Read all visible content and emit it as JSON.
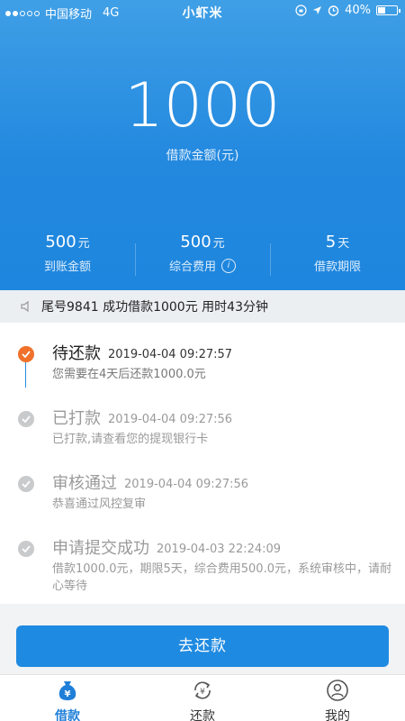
{
  "status_bar": {
    "carrier": "中国移动",
    "network": "4G",
    "center_text": "小虾米",
    "battery": "40%",
    "battery_level": 0.4
  },
  "loan": {
    "amount": "1000",
    "amount_label": "借款金额(元)",
    "stats": [
      {
        "value": "500",
        "unit": "元",
        "label": "到账金额"
      },
      {
        "value": "500",
        "unit": "元",
        "label": "综合费用"
      },
      {
        "value": "5",
        "unit": "天",
        "label": "借款期限"
      }
    ]
  },
  "notice": {
    "text": "尾号9841 成功借款1000元 用时43分钟"
  },
  "timeline": [
    {
      "title": "待还款",
      "time": "2019-04-04 09:27:57",
      "desc": "您需要在4天后还款1000.0元",
      "state": "active"
    },
    {
      "title": "已打款",
      "time": "2019-04-04 09:27:56",
      "desc": "已打款,请查看您的提现银行卡",
      "state": "done"
    },
    {
      "title": "审核通过",
      "time": "2019-04-04 09:27:56",
      "desc": "恭喜通过风控复审",
      "state": "done"
    },
    {
      "title": "申请提交成功",
      "time": "2019-04-03 22:24:09",
      "desc": "借款1000.0元，期限5天，综合费用500.0元，系统审核中，请耐心等待",
      "state": "done"
    }
  ],
  "actions": {
    "repay_label": "去还款"
  },
  "tabbar": [
    {
      "label": "借款",
      "icon": "money-bag-icon",
      "active": true
    },
    {
      "label": "还款",
      "icon": "repay-cycle-icon",
      "active": false
    },
    {
      "label": "我的",
      "icon": "user-icon",
      "active": false
    }
  ],
  "colors": {
    "brand_blue": "#1f8ae1",
    "active_step": "#f0712b",
    "inactive_step": "#c9cacc"
  }
}
